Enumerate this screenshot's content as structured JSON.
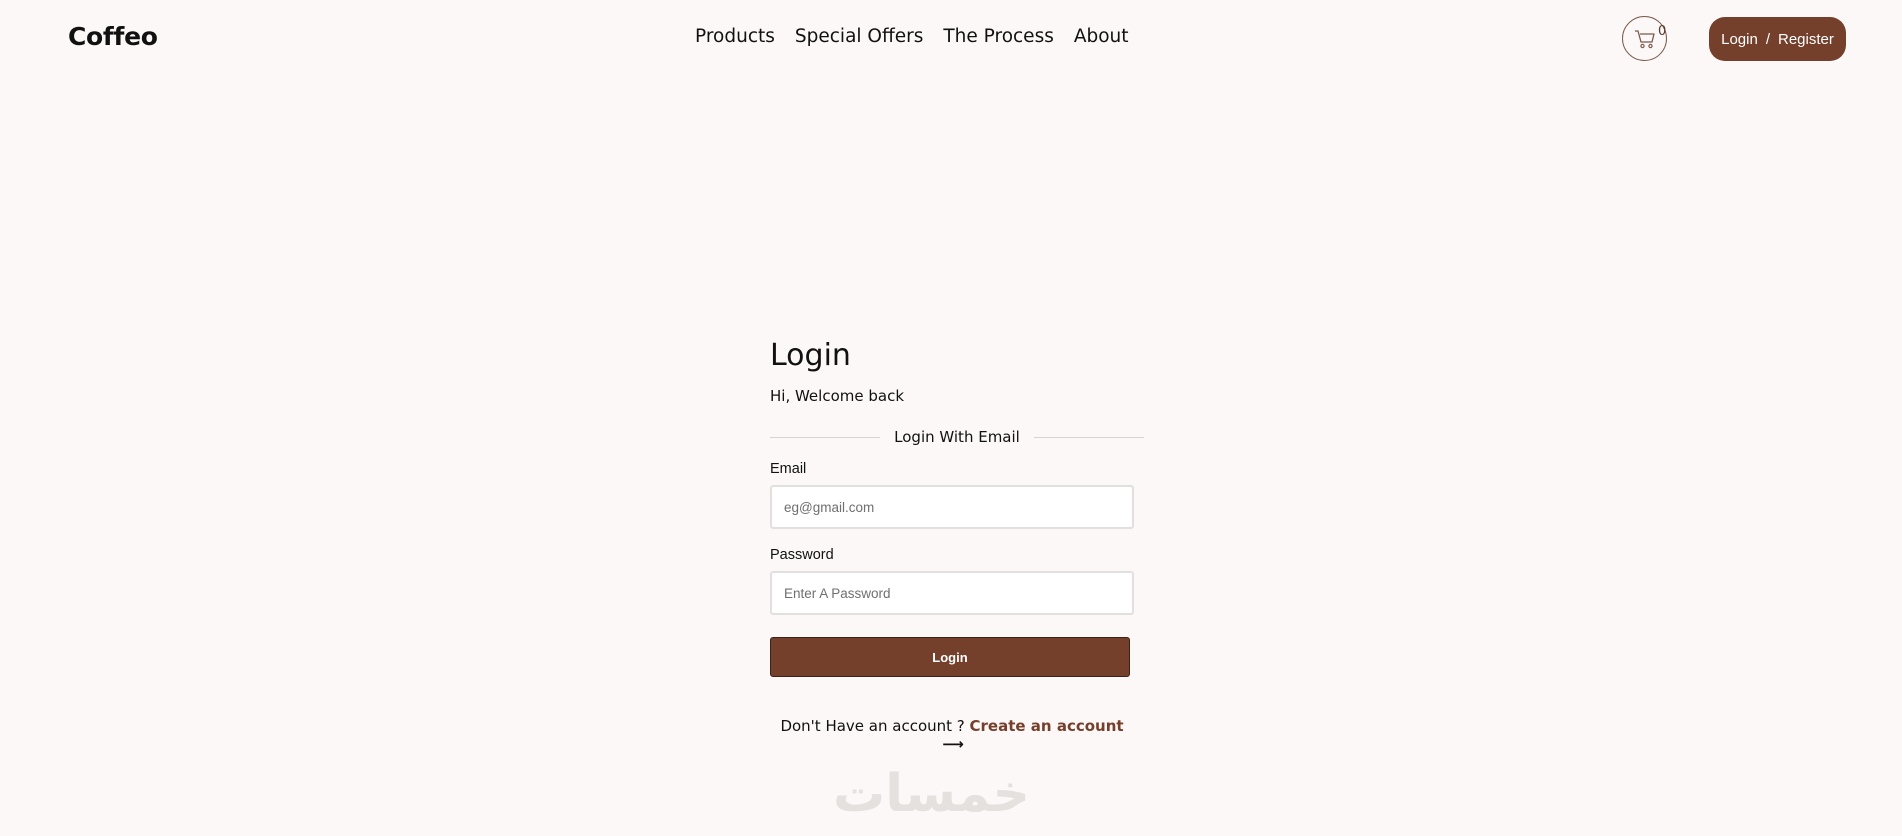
{
  "header": {
    "logo": "Coffeo",
    "nav": [
      "Products",
      "Special Offers",
      "The Process",
      "About"
    ],
    "cart": {
      "icon": "cart-icon",
      "count": "0"
    },
    "auth": {
      "login": "Login",
      "separator": "/",
      "register": "Register"
    }
  },
  "login": {
    "title": "Login",
    "subtitle": "Hi, Welcome back",
    "divider": "Login With Email",
    "email": {
      "label": "Email",
      "placeholder": "eg@gmail.com",
      "value": ""
    },
    "password": {
      "label": "Password",
      "placeholder": "Enter A Password",
      "value": ""
    },
    "submit": "Login",
    "signup_prompt": "Don't Have an account ?",
    "signup_link": "Create an account",
    "signup_arrow": "⟶"
  },
  "watermark": "خمسات",
  "colors": {
    "accent": "#743f2b",
    "background": "#fcf8f7"
  }
}
